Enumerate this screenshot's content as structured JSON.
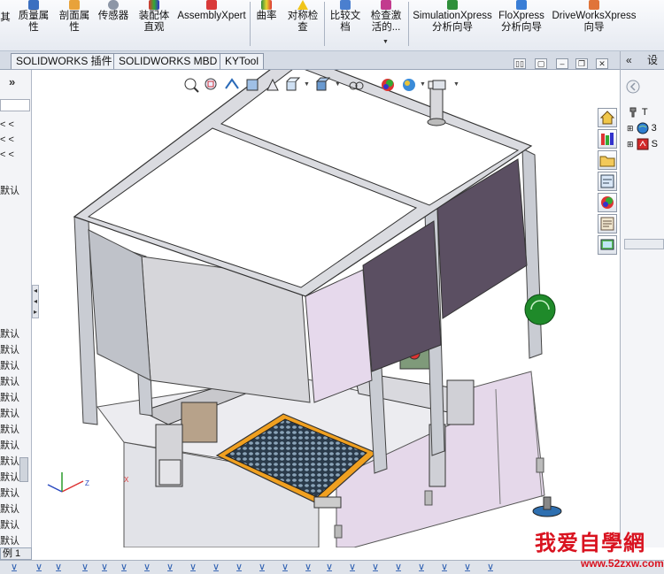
{
  "ribbon": {
    "buttons": [
      {
        "id": "mass-props",
        "label": "质量属\n性"
      },
      {
        "id": "section-props",
        "label": "剖面属\n性"
      },
      {
        "id": "sensor",
        "label": "传感器"
      },
      {
        "id": "assembly-visualization",
        "label": "装配体\n直观"
      },
      {
        "id": "assemblyxpert",
        "label": "AssemblyXpert"
      },
      {
        "id": "curvature",
        "label": "曲率"
      },
      {
        "id": "symmetry-check",
        "label": "对称检\n查"
      },
      {
        "id": "compare-documents",
        "label": "比较文\n档"
      },
      {
        "id": "check-active",
        "label": "检查激\n活的..."
      },
      {
        "id": "simulationxpress",
        "label": "SimulationXpress\n分析向导"
      },
      {
        "id": "floxpress",
        "label": "FloXpress\n分析向导"
      },
      {
        "id": "driveworksxpress",
        "label": "DriveWorksXpress\n向导"
      }
    ],
    "partial_left_label": "其"
  },
  "tabs": [
    "SOLIDWORKS 插件",
    "SOLIDWORKS MBD",
    "KYTool"
  ],
  "left_panel": {
    "collapse_glyph": "»",
    "items": [
      {
        "text": "< <"
      },
      {
        "text": "< <"
      },
      {
        "text": "< <"
      },
      {
        "text": "默认"
      },
      {
        "text": "默认"
      },
      {
        "text": "默认"
      },
      {
        "text": "默认"
      },
      {
        "text": "默认"
      },
      {
        "text": "默认"
      },
      {
        "text": "默认"
      },
      {
        "text": "默认"
      },
      {
        "text": "默认"
      },
      {
        "text": "默认"
      },
      {
        "text": "默认"
      },
      {
        "text": "默认"
      },
      {
        "text": "默认"
      },
      {
        "text": "默认"
      },
      {
        "text": "默认"
      }
    ]
  },
  "graphics": {
    "triad": {
      "x": "X",
      "y": "Y",
      "z": "Z"
    }
  },
  "task_pane": {
    "header_glyph": "«",
    "header_text": "设",
    "nodes": [
      {
        "label": "T"
      },
      {
        "label": "3"
      },
      {
        "label": "S"
      }
    ]
  },
  "bottom": {
    "sheet_tab": "例 1"
  },
  "watermark": {
    "text": "我爱自學網",
    "url": "www.52zxw.com"
  },
  "colors": {
    "frame": "#c9ccd3",
    "panel_lilac": "#e6d9ec",
    "panel_dark": "#5b4f62",
    "tray": "#f0a020",
    "accent_red": "#d9121f"
  }
}
